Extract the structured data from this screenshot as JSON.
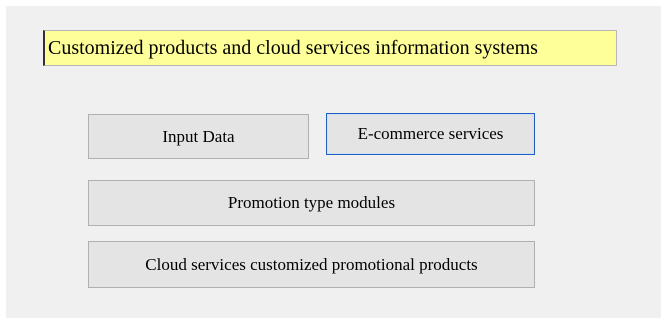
{
  "header": {
    "title": "Customized products and cloud services information systems"
  },
  "buttons": {
    "input_data": "Input Data",
    "ecommerce": "E-commerce services",
    "promotion": "Promotion type modules",
    "cloud": "Cloud services customized promotional products"
  },
  "colors": {
    "title_background": "#ffff99",
    "window_background": "#f0f0f0",
    "button_background": "#e4e4e4",
    "focus_border": "#1e5fbf"
  }
}
